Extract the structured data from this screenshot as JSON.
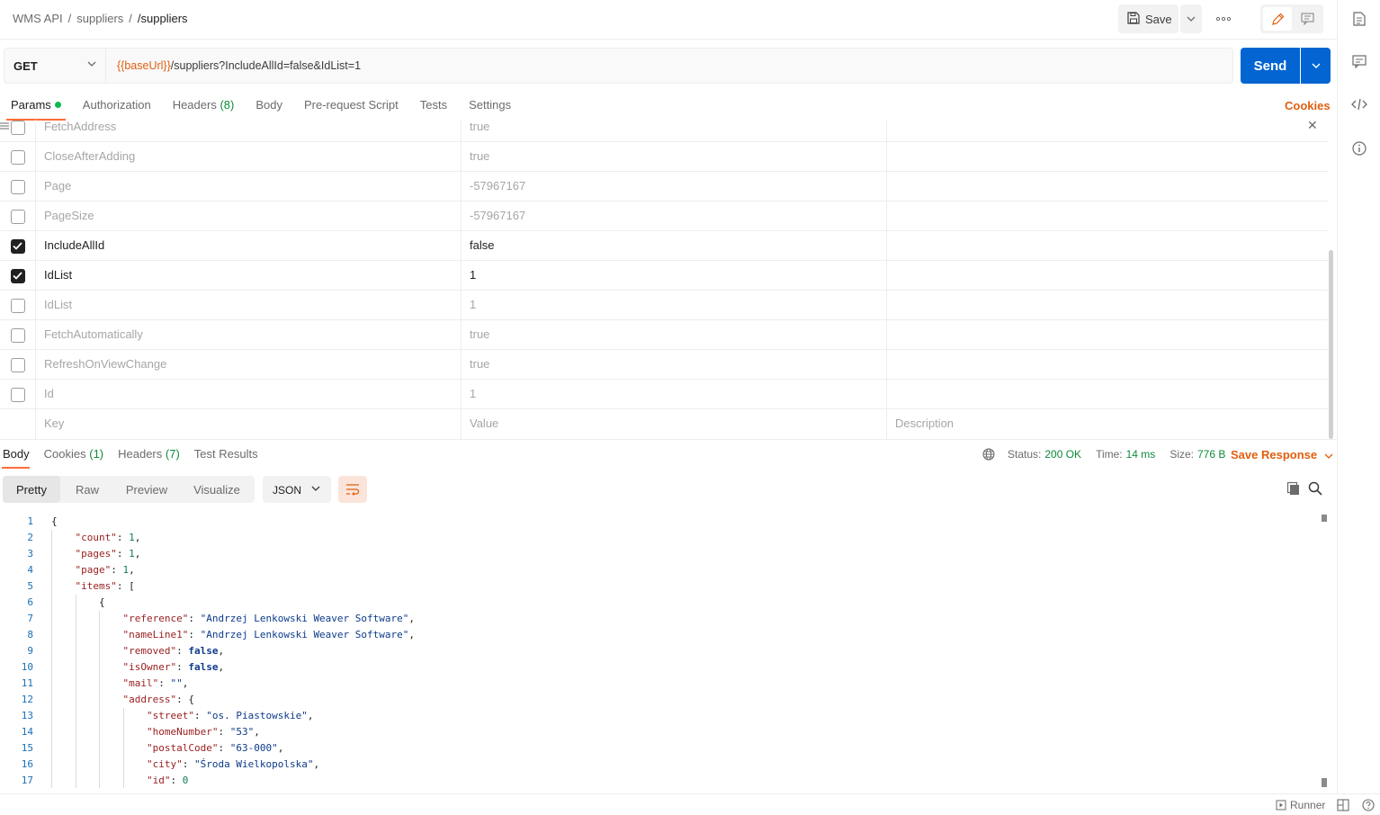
{
  "breadcrumb": [
    "WMS API",
    "suppliers",
    "/suppliers"
  ],
  "header": {
    "save_label": "Save"
  },
  "request": {
    "method": "GET",
    "url_variable": "{{baseUrl}}",
    "url_rest": "/suppliers?IncludeAllId=false&IdList=1",
    "send_label": "Send"
  },
  "req_tabs": [
    {
      "label": "Params",
      "active": true,
      "dot": true
    },
    {
      "label": "Authorization"
    },
    {
      "label": "Headers",
      "count": "(8)"
    },
    {
      "label": "Body"
    },
    {
      "label": "Pre-request Script"
    },
    {
      "label": "Tests"
    },
    {
      "label": "Settings"
    }
  ],
  "cookies_label": "Cookies",
  "params": [
    {
      "key": "FetchAddress",
      "value": "true",
      "checked": false
    },
    {
      "key": "CloseAfterAdding",
      "value": "true",
      "checked": false
    },
    {
      "key": "Page",
      "value": "-57967167",
      "checked": false
    },
    {
      "key": "PageSize",
      "value": "-57967167",
      "checked": false
    },
    {
      "key": "IncludeAllId",
      "value": "false",
      "checked": true
    },
    {
      "key": "IdList",
      "value": "1",
      "checked": true
    },
    {
      "key": "IdList",
      "value": "1",
      "checked": false
    },
    {
      "key": "FetchAutomatically",
      "value": "true",
      "checked": false
    },
    {
      "key": "RefreshOnViewChange",
      "value": "true",
      "checked": false
    },
    {
      "key": "Id",
      "value": "1",
      "checked": false
    }
  ],
  "params_placeholder": {
    "key": "Key",
    "value": "Value",
    "description": "Description"
  },
  "resp_tabs": [
    {
      "label": "Body",
      "active": true
    },
    {
      "label": "Cookies",
      "count": "(1)"
    },
    {
      "label": "Headers",
      "count": "(7)"
    },
    {
      "label": "Test Results"
    }
  ],
  "response_meta": {
    "status_label": "Status:",
    "status": "200 OK",
    "time_label": "Time:",
    "time": "14 ms",
    "size_label": "Size:",
    "size": "776 B"
  },
  "save_response_label": "Save Response",
  "view_modes": [
    "Pretty",
    "Raw",
    "Preview",
    "Visualize"
  ],
  "active_view": "Pretty",
  "format": "JSON",
  "code_lines": [
    {
      "n": "1",
      "indent": 0,
      "html": "{"
    },
    {
      "n": "2",
      "indent": 1,
      "html": "<span class=\"k\">\"count\"</span>: <span class=\"n\">1</span>,"
    },
    {
      "n": "3",
      "indent": 1,
      "html": "<span class=\"k\">\"pages\"</span>: <span class=\"n\">1</span>,"
    },
    {
      "n": "4",
      "indent": 1,
      "html": "<span class=\"k\">\"page\"</span>: <span class=\"n\">1</span>,"
    },
    {
      "n": "5",
      "indent": 1,
      "html": "<span class=\"k\">\"items\"</span>: ["
    },
    {
      "n": "6",
      "indent": 2,
      "html": "{"
    },
    {
      "n": "7",
      "indent": 3,
      "html": "<span class=\"k\">\"reference\"</span>: <span class=\"s\">\"Andrzej Lenkowski Weaver Software\"</span>,"
    },
    {
      "n": "8",
      "indent": 3,
      "html": "<span class=\"k\">\"nameLine1\"</span>: <span class=\"s\">\"Andrzej Lenkowski Weaver Software\"</span>,"
    },
    {
      "n": "9",
      "indent": 3,
      "html": "<span class=\"k\">\"removed\"</span>: <span class=\"b\">false</span>,"
    },
    {
      "n": "10",
      "indent": 3,
      "html": "<span class=\"k\">\"isOwner\"</span>: <span class=\"b\">false</span>,"
    },
    {
      "n": "11",
      "indent": 3,
      "html": "<span class=\"k\">\"mail\"</span>: <span class=\"s\">\"\"</span>,"
    },
    {
      "n": "12",
      "indent": 3,
      "html": "<span class=\"k\">\"address\"</span>: {"
    },
    {
      "n": "13",
      "indent": 4,
      "html": "<span class=\"k\">\"street\"</span>: <span class=\"s\">\"os. Piastowskie\"</span>,"
    },
    {
      "n": "14",
      "indent": 4,
      "html": "<span class=\"k\">\"homeNumber\"</span>: <span class=\"s\">\"53\"</span>,"
    },
    {
      "n": "15",
      "indent": 4,
      "html": "<span class=\"k\">\"postalCode\"</span>: <span class=\"s\">\"63-000\"</span>,"
    },
    {
      "n": "16",
      "indent": 4,
      "html": "<span class=\"k\">\"city\"</span>: <span class=\"s\">\"Środa Wielkopolska\"</span>,"
    },
    {
      "n": "17",
      "indent": 4,
      "html": "<span class=\"k\">\"id\"</span>: <span class=\"n\">0</span>"
    }
  ],
  "status_bar": {
    "runner_label": "Runner"
  }
}
